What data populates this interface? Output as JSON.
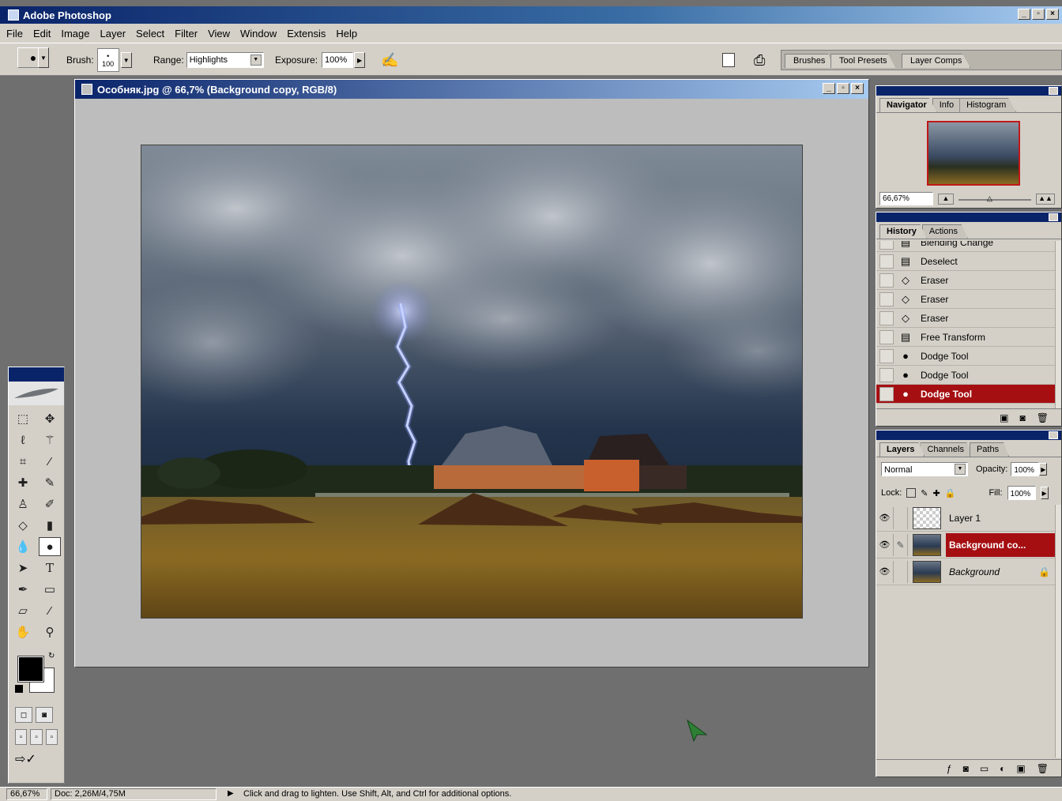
{
  "app": {
    "title": "Adobe Photoshop",
    "win_buttons": [
      "_",
      "▫",
      "×"
    ]
  },
  "menu": [
    "File",
    "Edit",
    "Image",
    "Layer",
    "Select",
    "Filter",
    "View",
    "Window",
    "Extensis",
    "Help"
  ],
  "options": {
    "brush_label": "Brush:",
    "brush_size": "100",
    "range_label": "Range:",
    "range_value": "Highlights",
    "exposure_label": "Exposure:",
    "exposure_value": "100%",
    "well_tabs": [
      "Brushes",
      "Tool Presets",
      "Layer Comps"
    ]
  },
  "document": {
    "title": "Особняк.jpg @ 66,7% (Background copy, RGB/8)"
  },
  "navigator": {
    "tabs": [
      "Navigator",
      "Info",
      "Histogram"
    ],
    "zoom": "66,67%"
  },
  "history": {
    "tabs": [
      "History",
      "Actions"
    ],
    "items": [
      {
        "label": "Blending Change",
        "icon": "document-icon",
        "glyph": "▤"
      },
      {
        "label": "Deselect",
        "icon": "document-icon",
        "glyph": "▤"
      },
      {
        "label": "Eraser",
        "icon": "eraser-icon",
        "glyph": "◇"
      },
      {
        "label": "Eraser",
        "icon": "eraser-icon",
        "glyph": "◇"
      },
      {
        "label": "Eraser",
        "icon": "eraser-icon",
        "glyph": "◇"
      },
      {
        "label": "Free Transform",
        "icon": "document-icon",
        "glyph": "▤"
      },
      {
        "label": "Dodge Tool",
        "icon": "dodge-icon",
        "glyph": "●"
      },
      {
        "label": "Dodge Tool",
        "icon": "dodge-icon",
        "glyph": "●"
      },
      {
        "label": "Dodge Tool",
        "icon": "dodge-icon",
        "glyph": "●"
      }
    ],
    "selected_index": 8
  },
  "layers": {
    "tabs": [
      "Layers",
      "Channels",
      "Paths"
    ],
    "blend_mode": "Normal",
    "opacity_label": "Opacity:",
    "opacity": "100%",
    "lock_label": "Lock:",
    "fill_label": "Fill:",
    "fill": "100%",
    "items": [
      {
        "name": "Layer 1",
        "selected": false
      },
      {
        "name": "Background co...",
        "selected": true
      },
      {
        "name": "Background",
        "selected": false
      }
    ]
  },
  "status": {
    "zoom": "66,67%",
    "doc_size": "Doc: 2,26M/4,75M",
    "hint": "Click and drag to lighten.  Use Shift, Alt, and Ctrl for additional options."
  },
  "colors": {
    "titlebar": "#0a246a",
    "selection": "#a50f12",
    "chrome": "#d4d0c8",
    "workspace": "#6f6f6f"
  }
}
